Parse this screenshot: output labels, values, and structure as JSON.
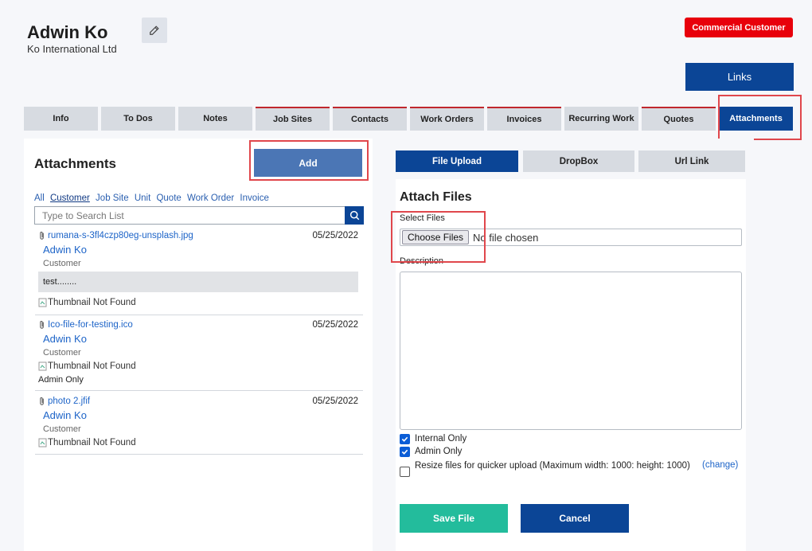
{
  "header": {
    "name": "Adwin Ko",
    "company": "Ko International Ltd",
    "badge": "Commercial Customer",
    "links_label": "Links"
  },
  "tabs": [
    {
      "label": "Info",
      "active": false
    },
    {
      "label": "To Dos",
      "active": false
    },
    {
      "label": "Notes",
      "active": false
    },
    {
      "label": "Job Sites",
      "active": false
    },
    {
      "label": "Contacts",
      "active": false
    },
    {
      "label": "Work Orders",
      "active": false
    },
    {
      "label": "Invoices",
      "active": false
    },
    {
      "label": "Recurring Work",
      "active": false
    },
    {
      "label": "Quotes",
      "active": false
    },
    {
      "label": "Attachments",
      "active": true
    }
  ],
  "attachments": {
    "title": "Attachments",
    "add_label": "Add",
    "filters": [
      "All",
      "Customer",
      "Job Site",
      "Unit",
      "Quote",
      "Work Order",
      "Invoice"
    ],
    "selected_filter": "Customer",
    "search_placeholder": "Type to Search List",
    "items": [
      {
        "file": "rumana-s-3fl4czp80eg-unsplash.jpg",
        "date": "05/25/2022",
        "owner": "Adwin Ko",
        "type": "Customer",
        "note": "test........",
        "thumb": "Thumbnail Not Found",
        "admin": ""
      },
      {
        "file": "Ico-file-for-testing.ico",
        "date": "05/25/2022",
        "owner": "Adwin Ko",
        "type": "Customer",
        "note": "",
        "thumb": "Thumbnail Not Found",
        "admin": "Admin Only"
      },
      {
        "file": "photo 2.jfif",
        "date": "05/25/2022",
        "owner": "Adwin Ko",
        "type": "Customer",
        "note": "",
        "thumb": "Thumbnail Not Found",
        "admin": ""
      }
    ]
  },
  "upload": {
    "tabs": [
      "File Upload",
      "DropBox",
      "Url Link"
    ],
    "active_tab": "File Upload",
    "title": "Attach Files",
    "select_files_label": "Select Files",
    "choose_label": "Choose Files",
    "no_file": "No file chosen",
    "description_label": "Description",
    "description_value": "",
    "internal_only": {
      "label": "Internal Only",
      "checked": true
    },
    "admin_only": {
      "label": "Admin Only",
      "checked": true
    },
    "resize": {
      "label": "Resize files for quicker upload (Maximum width: 1000: height: 1000)",
      "checked": false
    },
    "change_label": "(change)",
    "save_label": "Save File",
    "cancel_label": "Cancel"
  },
  "colors": {
    "primary": "#0b4596",
    "danger": "#e8000b",
    "success": "#23bc9c",
    "link": "#1d64c8",
    "highlight_outline": "#e0474c"
  }
}
